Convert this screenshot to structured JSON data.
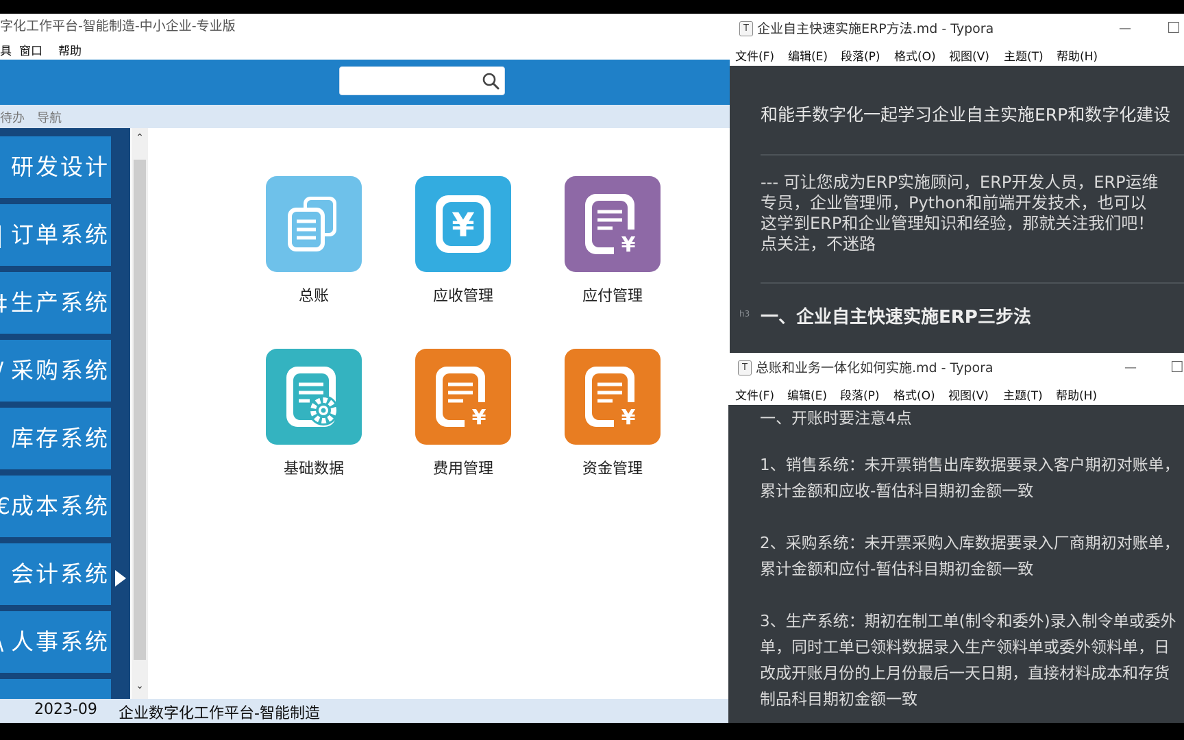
{
  "erp": {
    "title": "字化工作平台-智能制造-中小企业-专业版",
    "menu": [
      "具",
      "窗口",
      "帮助"
    ],
    "tabs": [
      "待办",
      "导航"
    ],
    "search": {
      "placeholder": ""
    },
    "sidebar": [
      {
        "label": "研发设计",
        "lead": ""
      },
      {
        "label": "订单系统",
        "lead": "|"
      },
      {
        "label": "生产系统",
        "lead": "‡"
      },
      {
        "label": "采购系统",
        "lead": "/"
      },
      {
        "label": "库存系统",
        "lead": ""
      },
      {
        "label": "成本系统",
        "lead": "€"
      },
      {
        "label": "会计系统",
        "lead": ""
      },
      {
        "label": "人事系统",
        "lead": "\\"
      }
    ],
    "modules": [
      {
        "label": "总账",
        "color": "#6ec1ea",
        "icon": "documents-icon"
      },
      {
        "label": "应收管理",
        "color": "#33ace0",
        "icon": "yuan-icon"
      },
      {
        "label": "应付管理",
        "color": "#8e69a6",
        "icon": "bill-yuan-icon"
      },
      {
        "label": "基础数据",
        "color": "#34b3c0",
        "icon": "gear-doc-icon"
      },
      {
        "label": "费用管理",
        "color": "#e87d22",
        "icon": "bill-yuan-icon"
      },
      {
        "label": "资金管理",
        "color": "#e87d22",
        "icon": "bill-yuan-icon"
      }
    ],
    "status": {
      "date": "2023-09",
      "platform": "企业数字化工作平台-智能制造"
    }
  },
  "typora1": {
    "title": "企业自主快速实施ERP方法.md - Typora",
    "menu": [
      "文件(F)",
      "编辑(E)",
      "段落(P)",
      "格式(O)",
      "视图(V)",
      "主题(T)",
      "帮助(H)"
    ],
    "heading": "和能手数字化一起学习企业自主实施ERP和数字化建设",
    "para": [
      "--- 可让您成为ERP实施顾问，ERP开发人员，ERP运维",
      "专员，企业管理师，Python和前端开发技术，也可以",
      "这学到ERP和企业管理知识和经验，那就关注我们吧！",
      "点关注，不迷路"
    ],
    "h2_marker": "h3",
    "h2": "一、企业自主快速实施ERP三步法"
  },
  "typora2": {
    "title": "总账和业务一体化如何实施.md - Typora",
    "menu": [
      "文件(F)",
      "编辑(E)",
      "段落(P)",
      "格式(O)",
      "视图(V)",
      "主题(T)",
      "帮助(H)"
    ],
    "lines": [
      "一、开账时要注意4点",
      "1、销售系统：未开票销售出库数据要录入客户期初对账单，",
      "累计金额和应收-暂估科目期初金额一致",
      "2、采购系统：未开票采购入库数据要录入厂商期初对账单，",
      "累计金额和应付-暂估科目期初金额一致",
      "3、生产系统：期初在制工单(制令和委外)录入制令单或委外",
      "单，同时工单已领料数据录入生产领料单或委外领料单，日",
      "改成开账月份的上月份最后一天日期，直接材料成本和存货",
      "制品科目期初金额一致"
    ]
  }
}
